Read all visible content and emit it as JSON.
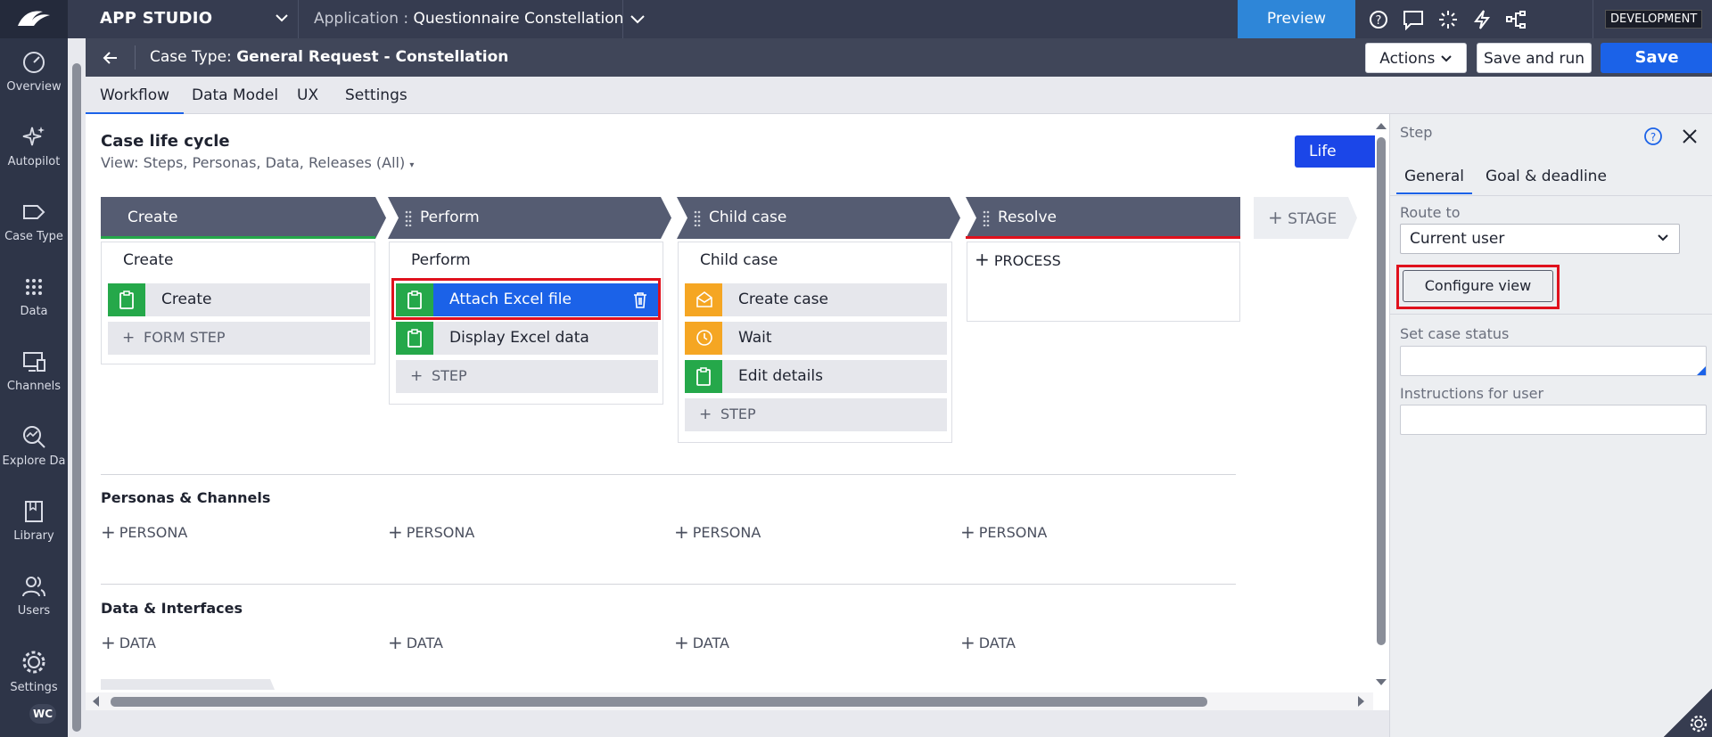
{
  "nav": {
    "items": [
      {
        "label": "Overview",
        "icon": "speedometer-icon"
      },
      {
        "label": "Autopilot",
        "icon": "sparkle-icon"
      },
      {
        "label": "Case Type",
        "icon": "tag-icon"
      },
      {
        "label": "Data",
        "icon": "grid-dots-icon"
      },
      {
        "label": "Channels",
        "icon": "monitor-icon"
      },
      {
        "label": "Explore Da",
        "icon": "chart-search-icon"
      },
      {
        "label": "Library",
        "icon": "book-icon"
      },
      {
        "label": "Users",
        "icon": "users-icon"
      },
      {
        "label": "Settings",
        "icon": "gear-icon"
      }
    ],
    "avatar": "WC"
  },
  "topbar": {
    "studio": "APP STUDIO",
    "app_label": "Application :",
    "app_name": "Questionnaire Constellation",
    "preview": "Preview",
    "env_badge": "DEVELOPMENT"
  },
  "casebar": {
    "prefix": "Case Type:",
    "name": "General Request - Constellation",
    "actions": "Actions",
    "save_run": "Save and run",
    "save": "Save"
  },
  "tabs": [
    "Workflow",
    "Data Model",
    "UX",
    "Settings"
  ],
  "lifecycle": {
    "title": "Case life cycle",
    "view": "View: Steps, Personas, Data, Releases (All)",
    "lifecycle_button": "Life cycle",
    "add_stage": "STAGE",
    "stages": [
      {
        "name": "Create",
        "process": "Create",
        "line_color": "#25a84a",
        "steps": [
          {
            "label": "Create",
            "icon": "clipboard-icon",
            "color": "green"
          }
        ],
        "add_label": "FORM STEP"
      },
      {
        "name": "Perform",
        "process": "Perform",
        "line_color": "",
        "steps": [
          {
            "label": "Attach Excel file",
            "icon": "clipboard-icon",
            "color": "green",
            "selected": true
          },
          {
            "label": "Display Excel data",
            "icon": "clipboard-icon",
            "color": "green"
          }
        ],
        "add_label": "STEP"
      },
      {
        "name": "Child case",
        "process": "Child case",
        "line_color": "",
        "steps": [
          {
            "label": "Create case",
            "icon": "envelope-open-icon",
            "color": "orange"
          },
          {
            "label": "Wait",
            "icon": "clock-icon",
            "color": "orange"
          },
          {
            "label": "Edit details",
            "icon": "clipboard-icon",
            "color": "green"
          }
        ],
        "add_label": "STEP"
      },
      {
        "name": "Resolve",
        "line_color": "#e0111d",
        "add_process": "PROCESS"
      }
    ]
  },
  "personas": {
    "title": "Personas & Channels",
    "add": "PERSONA"
  },
  "data_interfaces": {
    "title": "Data & Interfaces",
    "add": "DATA"
  },
  "panel": {
    "title": "Step",
    "tabs": [
      "General",
      "Goal & deadline"
    ],
    "route_label": "Route to",
    "route_value": "Current user",
    "configure": "Configure view",
    "status_label": "Set case status",
    "status_value": "",
    "instructions_label": "Instructions for user",
    "instructions_value": ""
  },
  "colors": {
    "accent": "#1b62e8",
    "highlight": "#e0111d",
    "step_green": "#25a84a",
    "step_orange": "#f5a623"
  }
}
